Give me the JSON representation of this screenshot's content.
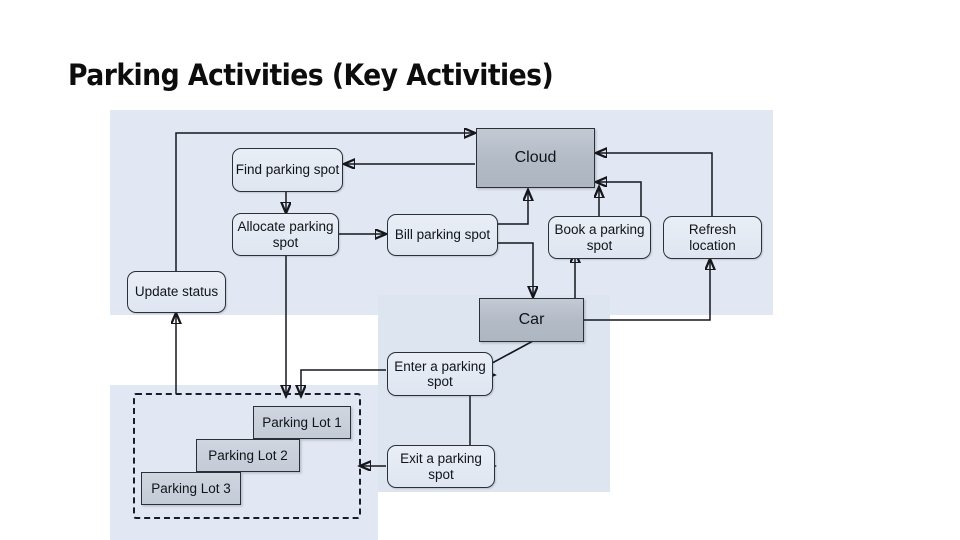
{
  "title": "Parking Activities (Key Activities)",
  "colors": {
    "panel": "#e2e8f3",
    "panel_mid": "#dde5f1",
    "node_fill": "#e4eaf4",
    "actor_fill": "#b8c0cb",
    "lot_fill": "#c9d1dc",
    "stroke": "#15171d",
    "title": "#0d0d0d"
  },
  "diagram": {
    "type": "activity-flow",
    "actors": [
      {
        "id": "cloud",
        "label": "Cloud"
      },
      {
        "id": "car",
        "label": "Car"
      }
    ],
    "activities": [
      {
        "id": "find-parking-spot",
        "label": "Find parking spot"
      },
      {
        "id": "allocate-parking-spot",
        "label": "Allocate parking spot"
      },
      {
        "id": "bill-parking-spot",
        "label": "Bill parking spot"
      },
      {
        "id": "book-a-parking-spot",
        "label": "Book a parking spot"
      },
      {
        "id": "refresh-location",
        "label": "Refresh location"
      },
      {
        "id": "update-status",
        "label": "Update status"
      },
      {
        "id": "enter-a-parking-spot",
        "label": "Enter a parking spot"
      },
      {
        "id": "exit-a-parking-spot",
        "label": "Exit a parking spot"
      }
    ],
    "parking_lots": [
      {
        "id": "parking-lot-1",
        "label": "Parking Lot 1"
      },
      {
        "id": "parking-lot-2",
        "label": "Parking Lot 2"
      },
      {
        "id": "parking-lot-3",
        "label": "Parking Lot 3"
      }
    ],
    "edges": [
      {
        "from": "update-status",
        "to": "cloud"
      },
      {
        "from": "cloud",
        "to": "find-parking-spot"
      },
      {
        "from": "find-parking-spot",
        "to": "allocate-parking-spot"
      },
      {
        "from": "allocate-parking-spot",
        "to": "bill-parking-spot"
      },
      {
        "from": "allocate-parking-spot",
        "to": "parking-lots"
      },
      {
        "from": "bill-parking-spot",
        "to": "cloud"
      },
      {
        "from": "bill-parking-spot",
        "to": "car"
      },
      {
        "from": "book-a-parking-spot",
        "to": "cloud"
      },
      {
        "from": "refresh-location",
        "to": "cloud"
      },
      {
        "from": "car",
        "to": "book-a-parking-spot"
      },
      {
        "from": "car",
        "to": "refresh-location"
      },
      {
        "from": "car",
        "to": "enter-a-parking-spot"
      },
      {
        "from": "car",
        "to": "exit-a-parking-spot"
      },
      {
        "from": "enter-a-parking-spot",
        "to": "parking-lots"
      },
      {
        "from": "exit-a-parking-spot",
        "to": "parking-lots"
      },
      {
        "from": "parking-lots",
        "to": "update-status"
      }
    ]
  }
}
